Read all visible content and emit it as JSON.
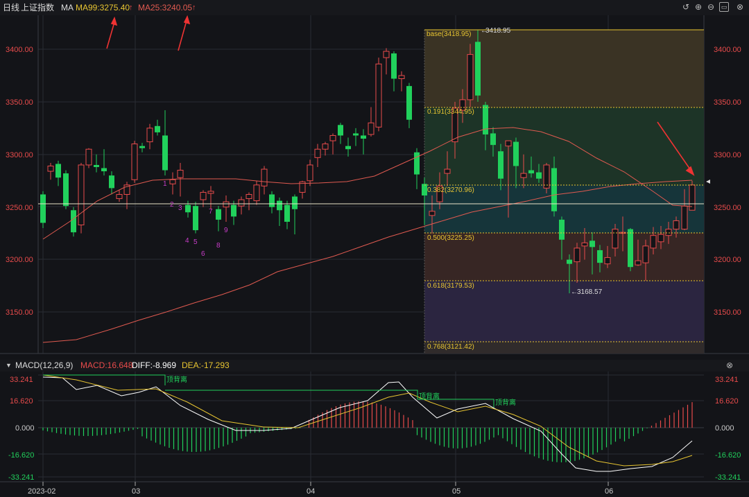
{
  "topbar": {
    "period": "日线",
    "name": "上证指数",
    "ma_label": "MA",
    "ma99": "MA99:3275.40",
    "ma25": "MA25:3240.05",
    "icons": [
      "undo-icon",
      "zoom-in-icon",
      "zoom-out-icon",
      "settings-icon",
      "close-icon"
    ]
  },
  "price_axis": {
    "ticks": [
      "3400.00",
      "3350.00",
      "3300.00",
      "3250.00",
      "3200.00",
      "3150.00"
    ]
  },
  "fib": {
    "base": "base(3418.95)",
    "base_mark": "3418.95",
    "l191": "0.191(3344.95)",
    "l382": "0.382(3270.96)",
    "l500": "0.500(3225.25)",
    "l618": "0.618(3179.53)",
    "l768": "0.768(3121.42)",
    "low_mark": "3168.57"
  },
  "wave_labels": [
    "1",
    "2",
    "3",
    "4",
    "5",
    "6",
    "7",
    "8",
    "9"
  ],
  "macd": {
    "title": "MACD(12,26,9)",
    "macd": "MACD:16.648",
    "diff": "DIFF:-8.969",
    "dea": "DEA:-17.293",
    "ticks": [
      "33.241",
      "16.620",
      "0.000",
      "-16.620",
      "-33.241"
    ],
    "divergence": [
      "顶背离",
      "顶背离",
      "顶背离"
    ]
  },
  "date_axis": [
    "2023-02",
    "03",
    "04",
    "05",
    "06"
  ],
  "colors": {
    "up": "#e84b4b",
    "down": "#21d15c",
    "ma25": "#e05a50",
    "ma99": "#e05a50",
    "fib_line": "#e8c531",
    "diff": "#ffffff",
    "dea": "#e8c531"
  }
}
